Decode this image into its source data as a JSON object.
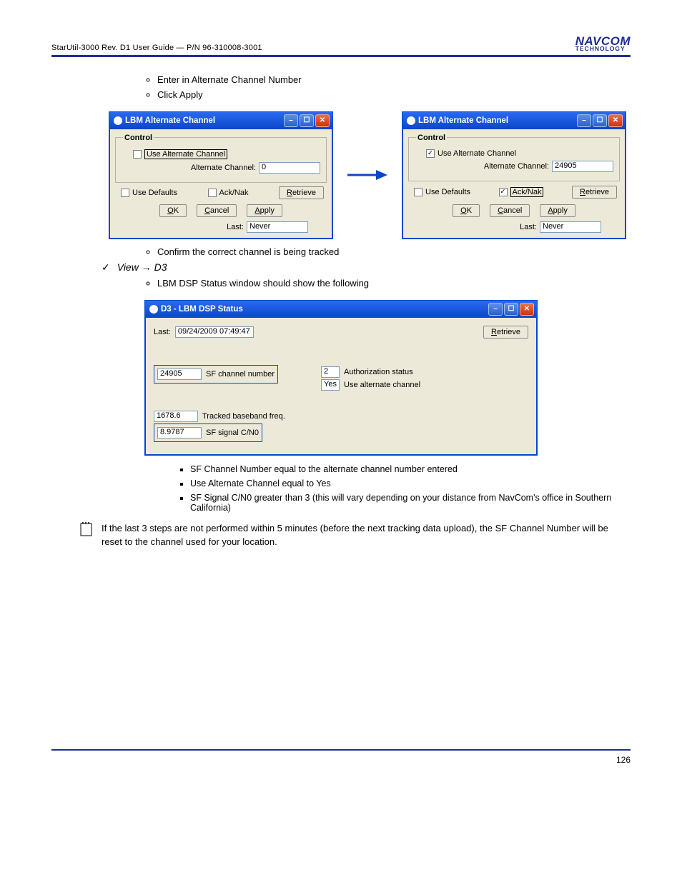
{
  "header": {
    "left": "StarUtil-3000 Rev. D1 User Guide — P/N 96-310008-3001",
    "tm": "TM",
    "logo_main": "NAVCOM",
    "logo_sub": "TECHNOLOGY"
  },
  "bullets": {
    "b1": "Enter in Alternate Channel Number",
    "b2": "Click Apply"
  },
  "dlg": {
    "title": "LBM Alternate Channel",
    "control_legend": "Control",
    "use_alt": "Use Alternate Channel",
    "alt_label": "Alternate Channel:",
    "acknak": "Ack/Nak",
    "use_defaults": "Use Defaults",
    "retrieve": "Retrieve",
    "ok": "OK",
    "ok_u": "O",
    "cancel": "Cancel",
    "cancel_u": "C",
    "apply": "Apply",
    "apply_u": "A",
    "last": "Last:",
    "never": "Never",
    "val_left": "0",
    "val_right": "24905"
  },
  "conf": "Confirm the correct channel is being tracked",
  "check_line": "View → D3",
  "below_check": "LBM DSP Status window should show the following",
  "d3": {
    "title": "D3 - LBM DSP Status",
    "last_label": "Last:",
    "last_val": "09/24/2009 07:49:47",
    "retrieve": "Retrieve",
    "sf_num": "24905",
    "sf_lbl": "SF channel number",
    "auth_val": "2",
    "auth_lbl": "Authorization status",
    "use_alt_val": "Yes",
    "use_alt_lbl": "Use alternate channel",
    "tb_val": "1678.6",
    "tb_lbl": "Tracked baseband freq.",
    "cn_val": "8.9787",
    "cn_lbl": "SF signal C/N0"
  },
  "checks": {
    "c1": "SF Channel Number equal to the alternate channel number entered",
    "c2": "Use Alternate Channel equal to Yes",
    "c3": "SF Signal C/N0 greater than 3 (this will vary depending on your distance from NavCom's office in Southern California)"
  },
  "note": "If the last 3 steps are not performed within 5 minutes (before the next tracking data upload), the SF Channel Number will be reset to the channel used for your location.",
  "page_num": "126"
}
